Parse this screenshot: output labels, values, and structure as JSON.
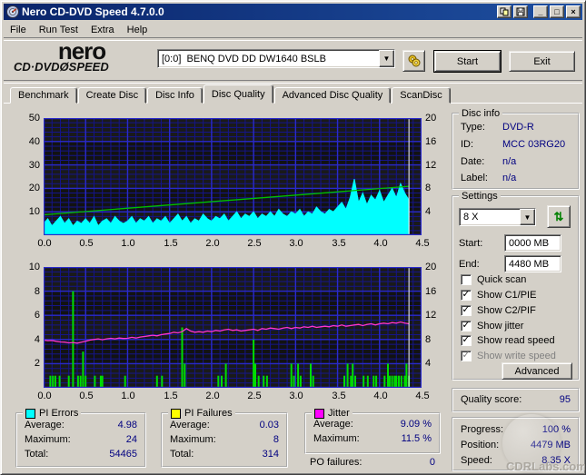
{
  "window": {
    "title": "Nero CD-DVD Speed 4.7.0.0"
  },
  "titlebar_buttons": {
    "minimize": "_",
    "maximize": "□",
    "close": "×"
  },
  "menu": {
    "items": [
      "File",
      "Run Test",
      "Extra",
      "Help"
    ]
  },
  "toolbar": {
    "logo_line1": "nero",
    "logo_line2": "CD·DVDØSPEED",
    "drive_select": "[0:0]  BENQ DVD DD DW1640 BSLB",
    "start_label": "Start",
    "exit_label": "Exit"
  },
  "tabs": {
    "items": [
      "Benchmark",
      "Create Disc",
      "Disc Info",
      "Disc Quality",
      "Advanced Disc Quality",
      "ScanDisc"
    ],
    "active": "Disc Quality"
  },
  "disc_info": {
    "title": "Disc info",
    "rows": [
      {
        "label": "Type:",
        "value": "DVD-R"
      },
      {
        "label": "ID:",
        "value": "MCC 03RG20"
      },
      {
        "label": "Date:",
        "value": "n/a"
      },
      {
        "label": "Label:",
        "value": "n/a"
      }
    ]
  },
  "settings": {
    "title": "Settings",
    "speed_value": "8 X",
    "start_label": "Start:",
    "start_value": "0000 MB",
    "end_label": "End:",
    "end_value": "4480 MB",
    "checkboxes": [
      {
        "label": "Quick scan",
        "checked": false,
        "disabled": false
      },
      {
        "label": "Show C1/PIE",
        "checked": true,
        "disabled": false
      },
      {
        "label": "Show C2/PIF",
        "checked": true,
        "disabled": false
      },
      {
        "label": "Show jitter",
        "checked": true,
        "disabled": false
      },
      {
        "label": "Show read speed",
        "checked": true,
        "disabled": false
      },
      {
        "label": "Show write speed",
        "checked": true,
        "disabled": true
      }
    ],
    "advanced_label": "Advanced"
  },
  "quality": {
    "label": "Quality score:",
    "value": "95"
  },
  "progress": {
    "rows": [
      {
        "label": "Progress:",
        "value": "100 %"
      },
      {
        "label": "Position:",
        "value": "4479 MB"
      },
      {
        "label": "Speed:",
        "value": "8.35 X"
      }
    ]
  },
  "stats": {
    "pi_errors": {
      "title": "PI Errors",
      "swatch": "#00ffff",
      "rows": [
        {
          "label": "Average:",
          "value": "4.98"
        },
        {
          "label": "Maximum:",
          "value": "24"
        },
        {
          "label": "Total:",
          "value": "54465"
        }
      ]
    },
    "pi_failures": {
      "title": "PI Failures",
      "swatch": "#ffff00",
      "rows": [
        {
          "label": "Average:",
          "value": "0.03"
        },
        {
          "label": "Maximum:",
          "value": "8"
        },
        {
          "label": "Total:",
          "value": "314"
        }
      ]
    },
    "jitter": {
      "title": "Jitter",
      "swatch": "#ff00ff",
      "rows": [
        {
          "label": "Average:",
          "value": "9.09 %"
        },
        {
          "label": "Maximum:",
          "value": "11.5 %"
        }
      ]
    },
    "po_failures": {
      "label": "PO failures:",
      "value": "0"
    }
  },
  "watermark": {
    "text": "CDRLabs.com"
  },
  "colors": {
    "titlebar": "#0a246a",
    "chrome": "#d4d0c8",
    "value_text": "#000080",
    "plot_bg": "#121212",
    "grid_major": "#2a2acc",
    "grid_minor": "#15158a",
    "pie_area": "#00ffff",
    "pif_bars": "#00dd00",
    "speed_line": "#00c000",
    "jitter_line": "#ff35cc",
    "cursor": "#ffffff"
  },
  "chart_data": [
    {
      "type": "area",
      "name": "pi-errors-scan",
      "x_max": 4.5,
      "x_major": 0.5,
      "x_minor": 0.1,
      "x_ticks": [
        "0.0",
        "0.5",
        "1.0",
        "1.5",
        "2.0",
        "2.5",
        "3.0",
        "3.5",
        "4.0",
        "4.5"
      ],
      "left_axis": {
        "max": 50,
        "major": 10,
        "minor": 2,
        "ticks": [
          50,
          40,
          30,
          20,
          10
        ]
      },
      "right_axis": {
        "max": 20,
        "major": 4,
        "ticks": [
          20,
          16,
          12,
          8,
          4
        ]
      },
      "cursor_x": 4.35,
      "series": [
        {
          "name": "pi_errors",
          "kind": "area",
          "color": "#00ffff",
          "axis": "left",
          "x0": 0,
          "dx": 0.05,
          "values": [
            5,
            7,
            4,
            6,
            8,
            5,
            7,
            4,
            6,
            5,
            7,
            5,
            8,
            4,
            6,
            7,
            5,
            8,
            6,
            5,
            6,
            8,
            5,
            7,
            6,
            8,
            5,
            7,
            6,
            8,
            5,
            7,
            9,
            6,
            8,
            5,
            7,
            6,
            9,
            7,
            6,
            8,
            7,
            9,
            6,
            8,
            10,
            7,
            9,
            8,
            10,
            7,
            9,
            8,
            10,
            8,
            11,
            9,
            8,
            10,
            9,
            11,
            8,
            10,
            9,
            12,
            10,
            9,
            11,
            10,
            12,
            14,
            11,
            16,
            24,
            14,
            18,
            13,
            17,
            15,
            19,
            14,
            17,
            20,
            16,
            22,
            18,
            15
          ]
        },
        {
          "name": "read_speed",
          "kind": "line",
          "color": "#00c000",
          "axis": "right",
          "points": [
            [
              0,
              3.49
            ],
            [
              4.35,
              8.35
            ]
          ]
        }
      ]
    },
    {
      "type": "bar",
      "name": "pi-failures-scan",
      "x_max": 4.5,
      "x_major": 0.5,
      "x_minor": 0.1,
      "x_ticks": [
        "0.0",
        "0.5",
        "1.0",
        "1.5",
        "2.0",
        "2.5",
        "3.0",
        "3.5",
        "4.0",
        "4.5"
      ],
      "left_axis": {
        "max": 10,
        "major": 2,
        "minor": 0.4,
        "ticks": [
          10,
          8,
          6,
          4,
          2
        ]
      },
      "right_axis": {
        "max": 20,
        "major": 4,
        "ticks": [
          20,
          16,
          12,
          8,
          4
        ]
      },
      "cursor_x": 4.35,
      "series": [
        {
          "name": "pi_failures",
          "kind": "bars",
          "color": "#00dd00",
          "axis": "left",
          "bars": [
            [
              0.08,
              1
            ],
            [
              0.11,
              1
            ],
            [
              0.14,
              1
            ],
            [
              0.19,
              1
            ],
            [
              0.3,
              1
            ],
            [
              0.35,
              8
            ],
            [
              0.41,
              1
            ],
            [
              0.44,
              1
            ],
            [
              0.47,
              3
            ],
            [
              0.5,
              1
            ],
            [
              0.61,
              1
            ],
            [
              0.68,
              1
            ],
            [
              0.7,
              1
            ],
            [
              0.97,
              1
            ],
            [
              1.35,
              1
            ],
            [
              1.41,
              1
            ],
            [
              1.65,
              5
            ],
            [
              1.68,
              2
            ],
            [
              2.08,
              1
            ],
            [
              2.12,
              1
            ],
            [
              2.17,
              2
            ],
            [
              2.5,
              4
            ],
            [
              2.52,
              2
            ],
            [
              2.56,
              1
            ],
            [
              2.62,
              1
            ],
            [
              2.66,
              1
            ],
            [
              2.95,
              2
            ],
            [
              2.98,
              1
            ],
            [
              3.03,
              2
            ],
            [
              3.06,
              1
            ],
            [
              3.18,
              2
            ],
            [
              3.21,
              1
            ],
            [
              3.58,
              1
            ],
            [
              3.62,
              2
            ],
            [
              3.66,
              1
            ],
            [
              3.68,
              2
            ],
            [
              3.71,
              1
            ],
            [
              3.81,
              1
            ],
            [
              3.86,
              1
            ],
            [
              3.93,
              1
            ],
            [
              3.96,
              1
            ],
            [
              4.06,
              1
            ],
            [
              4.1,
              2
            ],
            [
              4.12,
              1
            ],
            [
              4.15,
              1
            ],
            [
              4.18,
              1
            ],
            [
              4.2,
              1
            ],
            [
              4.23,
              1
            ],
            [
              4.26,
              1
            ],
            [
              4.3,
              1
            ],
            [
              4.32,
              2
            ],
            [
              4.35,
              1
            ]
          ]
        },
        {
          "name": "jitter",
          "kind": "line",
          "color": "#ff35cc",
          "axis": "left",
          "x0": 0,
          "dx": 0.05,
          "values": [
            3.95,
            3.9,
            3.92,
            3.85,
            3.8,
            3.78,
            3.72,
            3.75,
            3.7,
            3.78,
            3.85,
            3.95,
            4.0,
            4.05,
            3.98,
            4.05,
            4.1,
            4.05,
            4.12,
            4.08,
            4.1,
            4.18,
            4.12,
            4.2,
            4.25,
            4.3,
            4.35,
            4.3,
            4.4,
            4.45,
            4.5,
            4.6,
            4.55,
            4.65,
            4.9,
            4.7,
            4.6,
            4.65,
            4.6,
            4.7,
            4.65,
            4.75,
            4.7,
            4.8,
            4.85,
            4.75,
            4.8,
            4.7,
            4.75,
            4.8,
            4.85,
            4.75,
            4.9,
            4.85,
            4.95,
            4.9,
            4.85,
            4.95,
            5.0,
            4.9,
            5.0,
            4.95,
            5.05,
            5.0,
            5.1,
            5.0,
            5.05,
            5.1,
            5.05,
            5.15,
            5.1,
            5.2,
            5.1,
            5.15,
            5.2,
            5.25,
            5.15,
            5.25,
            5.3,
            5.2,
            5.3,
            5.35,
            5.3,
            5.4,
            5.35,
            5.45,
            5.35,
            5.3
          ]
        }
      ]
    }
  ]
}
